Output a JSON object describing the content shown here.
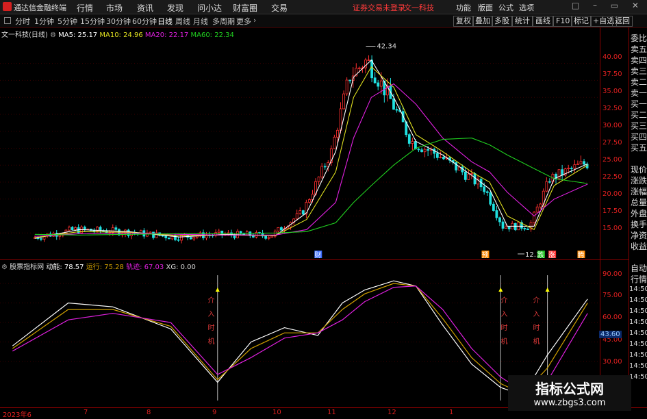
{
  "app": {
    "name": "通达信金融终端"
  },
  "menu": [
    "行情",
    "市场",
    "资讯",
    "发现",
    "问小达",
    "财富圈",
    "交易"
  ],
  "warning": "证券交易未登录",
  "stock_title": "文一科技",
  "menu_tools": [
    "功能",
    "版面",
    "公式",
    "选项"
  ],
  "window_controls": "□ – ▭ ✕",
  "periods": [
    "分时",
    "1分钟",
    "5分钟",
    "15分钟",
    "30分钟",
    "60分钟",
    "日线",
    "周线",
    "月线",
    "多周期",
    "更多"
  ],
  "period_active": "日线",
  "toolbar_right": [
    "复权",
    "叠加",
    "多股",
    "统计",
    "画线",
    "F10",
    "标记",
    "+自选",
    "返回"
  ],
  "main_legend": {
    "title": "文一科技(日线)",
    "ma5": "MA5: 25.17",
    "ma10": "MA10: 24.96",
    "ma20": "MA20: 22.17",
    "ma60": "MA60: 22.34"
  },
  "price_axis": [
    "40.00",
    "37.50",
    "35.00",
    "32.50",
    "30.00",
    "27.50",
    "25.00",
    "22.50",
    "20.00",
    "17.50",
    "15.00"
  ],
  "annotations": {
    "high": "42.34",
    "low": "12.11",
    "cai": "财",
    "yu": "预",
    "die": "跌",
    "zhang": "涨",
    "te": "腾"
  },
  "sub_legend": {
    "name": "股票指标网",
    "dongneng": "动能: 78.57",
    "yunxing": "运行: 75.28",
    "guiji": "轨迹: 67.03",
    "xg": "XG: 0.00"
  },
  "sub_axis": [
    "90.00",
    "75.00",
    "60.00",
    "45.00",
    "30.00"
  ],
  "sub_current": "43.60",
  "signal_text": "介入时机",
  "side_panel": [
    "委比",
    "卖五",
    "卖四",
    "卖三",
    "卖二",
    "卖一",
    "买一",
    "买二",
    "买三",
    "买四",
    "买五",
    "现价",
    "涨跌",
    "涨幅",
    "总量",
    "外盘",
    "换手",
    "净资",
    "收益"
  ],
  "side_lower": [
    "自动",
    "行情"
  ],
  "time_list": [
    "14:50",
    "14:50",
    "14:50",
    "14:50",
    "14:50",
    "14:50",
    "14:50",
    "14:50",
    "14:50"
  ],
  "x_axis": [
    "2023年6",
    "7",
    "8",
    "9",
    "10",
    "11",
    "12",
    "1"
  ],
  "watermark": {
    "title": "指标公式网",
    "url": "www.zbgs3.com"
  },
  "colors": {
    "up": "#ff3030",
    "down": "#20e0e0",
    "ma5": "#ffffff",
    "ma10": "#e0e020",
    "ma20": "#e020e0",
    "ma60": "#20d020",
    "axis": "#e02020"
  },
  "chart_data": [
    {
      "type": "line",
      "x": [
        "2023-06-20",
        "2023-07-10",
        "2023-08-01",
        "2023-08-24",
        "2023-09-13",
        "2023-10-06",
        "2023-10-20",
        "2023-11-02",
        "2023-11-10",
        "2023-11-18",
        "2023-11-28",
        "2023-12-08",
        "2023-12-20",
        "2024-01-02",
        "2024-01-10",
        "2024-01-18",
        "2024-01-30",
        "2024-02-08",
        "2024-02-23"
      ],
      "series": [
        {
          "name": "MA5",
          "values": [
            14.2,
            15.5,
            15.2,
            14.4,
            14.8,
            14.6,
            18.0,
            27.0,
            38.0,
            40.5,
            35.0,
            28.5,
            26.5,
            23.5,
            21.5,
            16.0,
            16.0,
            23.0,
            25.2
          ]
        },
        {
          "name": "MA10",
          "values": [
            14.3,
            15.2,
            15.1,
            14.6,
            14.7,
            14.6,
            17.0,
            24.0,
            35.0,
            39.5,
            36.5,
            29.5,
            27.0,
            24.0,
            22.5,
            17.5,
            15.5,
            22.0,
            25.0
          ]
        },
        {
          "name": "MA20",
          "values": [
            14.5,
            14.9,
            15.0,
            14.8,
            14.7,
            14.7,
            15.5,
            19.5,
            29.0,
            35.0,
            37.0,
            34.0,
            29.0,
            25.5,
            24.0,
            21.0,
            17.5,
            20.0,
            22.2
          ]
        },
        {
          "name": "MA60",
          "values": [
            14.8,
            14.7,
            14.8,
            14.9,
            14.9,
            15.0,
            15.2,
            16.5,
            19.5,
            22.0,
            25.0,
            27.5,
            28.8,
            29.0,
            28.0,
            26.5,
            24.5,
            23.0,
            22.3
          ]
        }
      ],
      "ylim": [
        12.0,
        43.5
      ]
    },
    {
      "type": "line",
      "x": [
        "2023-06-10",
        "2023-07-05",
        "2023-07-25",
        "2023-08-20",
        "2023-09-10",
        "2023-09-25",
        "2023-10-10",
        "2023-10-25",
        "2023-11-05",
        "2023-11-15",
        "2023-11-28",
        "2023-12-08",
        "2023-12-20",
        "2024-01-02",
        "2024-01-15",
        "2024-01-25",
        "2024-02-05",
        "2024-02-23"
      ],
      "series": [
        {
          "name": "动能",
          "values": [
            42,
            75,
            72,
            55,
            14,
            45,
            56,
            50,
            75,
            85,
            92,
            88,
            58,
            28,
            10,
            4,
            35,
            78
          ]
        },
        {
          "name": "运行",
          "values": [
            40,
            70,
            70,
            57,
            16,
            40,
            52,
            52,
            70,
            82,
            90,
            88,
            63,
            33,
            13,
            5,
            25,
            75
          ]
        },
        {
          "name": "轨迹",
          "values": [
            38,
            62,
            67,
            60,
            20,
            33,
            48,
            52,
            62,
            76,
            87,
            88,
            70,
            40,
            18,
            7,
            15,
            67
          ]
        }
      ],
      "ylim": [
        0,
        100
      ]
    }
  ]
}
